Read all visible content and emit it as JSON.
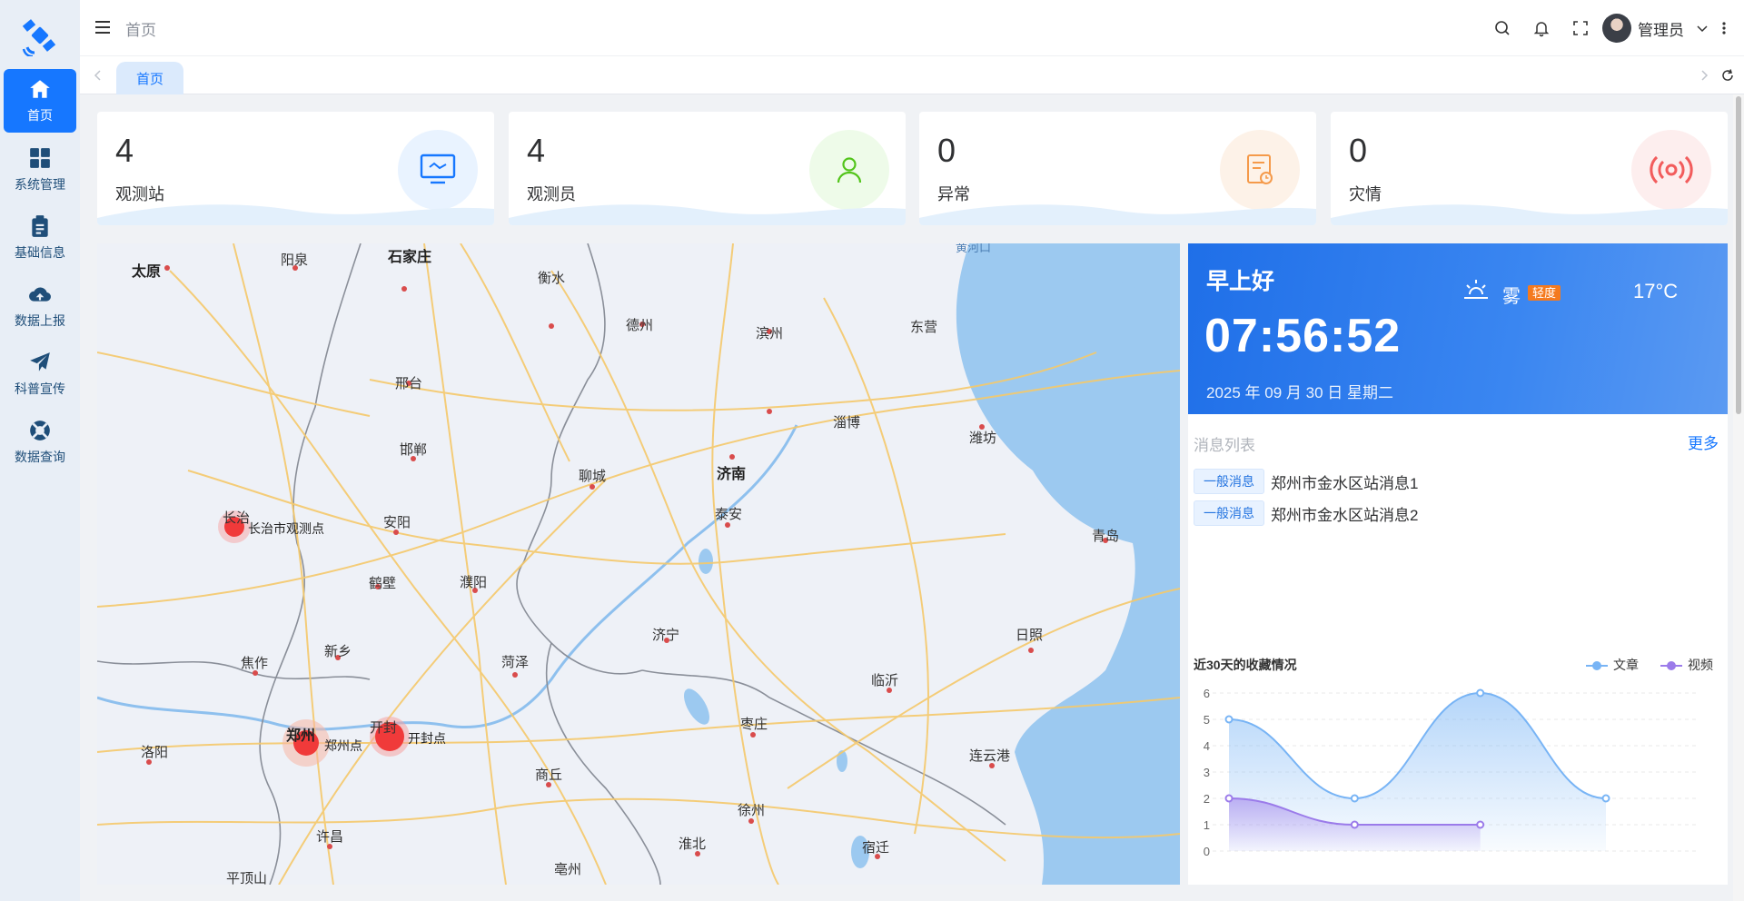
{
  "sidebar": {
    "logo": "satellite-logo",
    "items": [
      {
        "label": "首页",
        "icon": "home-icon",
        "active": true
      },
      {
        "label": "系统管理",
        "icon": "grid-icon",
        "active": false
      },
      {
        "label": "基础信息",
        "icon": "clipboard-icon",
        "active": false
      },
      {
        "label": "数据上报",
        "icon": "cloud-upload-icon",
        "active": false
      },
      {
        "label": "科普宣传",
        "icon": "paper-plane-icon",
        "active": false
      },
      {
        "label": "数据查询",
        "icon": "lifebuoy-icon",
        "active": false
      }
    ]
  },
  "header": {
    "breadcrumb": "首页",
    "user_name": "管理员"
  },
  "tabs": [
    {
      "label": "首页"
    }
  ],
  "stats": [
    {
      "value": "4",
      "label": "观测站",
      "icon": "monitor-icon",
      "color": "#1677ff",
      "bg": "#e9f3ff"
    },
    {
      "value": "4",
      "label": "观测员",
      "icon": "user-icon",
      "color": "#52c41a",
      "bg": "#eefbe9"
    },
    {
      "value": "0",
      "label": "异常",
      "icon": "report-icon",
      "color": "#f59a4a",
      "bg": "#fdf2e8"
    },
    {
      "value": "0",
      "label": "灾情",
      "icon": "broadcast-icon",
      "color": "#f25c5c",
      "bg": "#fdeeee"
    }
  ],
  "map": {
    "cities": [
      "太原",
      "阳泉",
      "石家庄",
      "衡水",
      "德州",
      "滨州",
      "东营",
      "邢台",
      "淄博",
      "邯郸",
      "潍坊",
      "聊城",
      "济南",
      "长治",
      "泰安",
      "安阳",
      "青岛",
      "鹤壁",
      "濮阳",
      "济宁",
      "新乡",
      "日照",
      "焦作",
      "菏泽",
      "临沂",
      "郑州",
      "开封",
      "枣庄",
      "洛阳",
      "连云港",
      "商丘",
      "徐州",
      "许昌",
      "淮北",
      "宿迁",
      "平顶山",
      "亳州",
      "黄河口"
    ],
    "markers": [
      {
        "label": "长治市观测点"
      },
      {
        "label": "郑州点"
      },
      {
        "label": "开封点"
      }
    ]
  },
  "welcome": {
    "greeting": "早上好",
    "time": "07:56:52",
    "date": "2025 年 09 月 30 日 星期二",
    "weather": "雾",
    "weather_level": "轻度",
    "temperature": "17°C"
  },
  "messages": {
    "title": "消息列表",
    "more": "更多",
    "items": [
      {
        "tag": "一般消息",
        "text": "郑州市金水区站消息1"
      },
      {
        "tag": "一般消息",
        "text": "郑州市金水区站消息2"
      }
    ]
  },
  "chart_data": {
    "type": "line",
    "title": "近30天的收藏情况",
    "series": [
      {
        "name": "文章",
        "color": "#78b4f5",
        "values": [
          5,
          2,
          6,
          2
        ]
      },
      {
        "name": "视频",
        "color": "#9b7bea",
        "values": [
          2,
          1,
          1
        ]
      }
    ],
    "yticks": [
      0,
      1,
      2,
      3,
      4,
      5,
      6
    ],
    "ylim": [
      0,
      6
    ],
    "smooth": true,
    "area": true
  }
}
